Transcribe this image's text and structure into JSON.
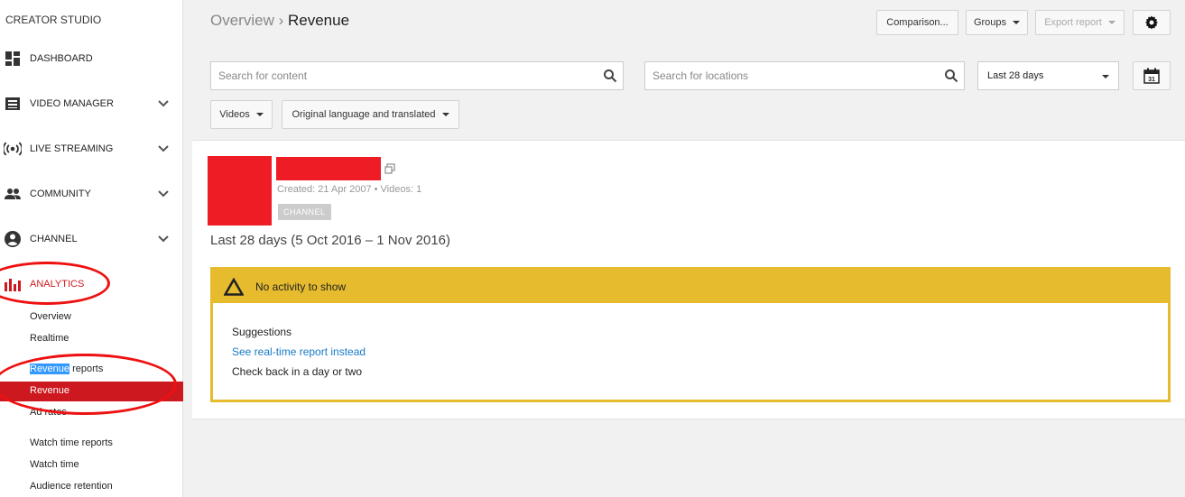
{
  "sidebar": {
    "brand": "CREATOR STUDIO",
    "items": [
      {
        "label": "DASHBOARD"
      },
      {
        "label": "VIDEO MANAGER"
      },
      {
        "label": "LIVE STREAMING"
      },
      {
        "label": "COMMUNITY"
      },
      {
        "label": "CHANNEL"
      },
      {
        "label": "ANALYTICS"
      }
    ],
    "analytics_sub": {
      "overview": "Overview",
      "realtime": "Realtime",
      "revenue_reports_highlight": "Revenue",
      "revenue_reports_rest": " reports",
      "revenue": "Revenue",
      "ad_rates": "Ad rates",
      "watch_time_reports": "Watch time reports",
      "watch_time": "Watch time",
      "audience_retention": "Audience retention"
    }
  },
  "header": {
    "breadcrumb_parent": "Overview",
    "breadcrumb_sep": " › ",
    "breadcrumb_current": "Revenue",
    "comparison_label": "Comparison...",
    "groups_label": "Groups",
    "export_label": "Export report"
  },
  "filters": {
    "search_content_placeholder": "Search for content",
    "search_locations_placeholder": "Search for locations",
    "date_range": "Last 28 days",
    "calendar_day": "31",
    "content_type": "Videos",
    "language": "Original language and translated"
  },
  "channel": {
    "meta": "Created: 21 Apr 2007  •  Videos: 1",
    "tag": "CHANNEL"
  },
  "report": {
    "period": "Last 28 days (5 Oct 2016 – 1 Nov 2016)",
    "alert_title": "No activity to show",
    "suggestions_title": "Suggestions",
    "suggestion_link": "See real-time report instead",
    "suggestion_text": "Check back in a day or two"
  },
  "colors": {
    "accent": "#cc181e",
    "warning": "#e6bc2e",
    "link": "#167ac6",
    "redacted": "#ee1c25"
  }
}
